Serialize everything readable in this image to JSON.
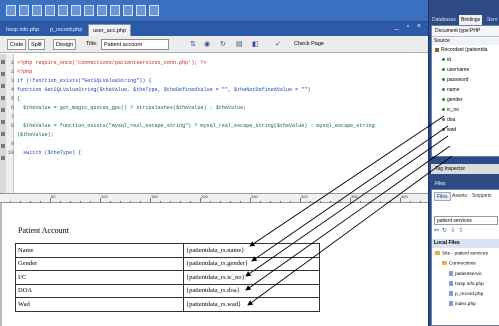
{
  "toolbar": {
    "icons": [
      "new-icon",
      "open-icon",
      "save-icon",
      "cut-icon",
      "copy-icon",
      "paste-icon",
      "undo-icon",
      "redo-icon",
      "insert-icon",
      "table-icon",
      "image-icon",
      "link-icon"
    ]
  },
  "tabs": [
    {
      "label": "hosp info.php"
    },
    {
      "label": "p_record.php"
    },
    {
      "label": "user_acc.php"
    }
  ],
  "window_controls": "_ ▫ ×",
  "view_bar": {
    "code": "Code",
    "split": "Split",
    "design": "Design",
    "title_label": "Title:",
    "title_value": "Patient account",
    "check_page": "Check Page"
  },
  "code_lines": [
    {
      "n": "1",
      "text": "<?php require_once('Connections/patientservices_conn.php'); ?>"
    },
    {
      "n": "2",
      "text": "<?php"
    },
    {
      "n": "3",
      "text": "if (!function_exists(\"GetSQLValueString\")) {"
    },
    {
      "n": "4",
      "text": "function GetSQLValueString($theValue, $theType, $theDefinedValue = \"\", $theNotDefinedValue = \"\")"
    },
    {
      "n": "5",
      "text": "{"
    },
    {
      "n": "6",
      "text": "  $theValue = get_magic_quotes_gpc() ? stripslashes($theValue) : $theValue;"
    },
    {
      "n": "7",
      "text": ""
    },
    {
      "n": "8",
      "text": "  $theValue = function_exists(\"mysql_real_escape_string\") ? mysql_real_escape_string($theValue) : mysql_escape_string"
    },
    {
      "n": "",
      "text": "($theValue);"
    },
    {
      "n": "9",
      "text": ""
    },
    {
      "n": "10",
      "text": "  switch ($theType) {"
    }
  ],
  "ruler_labels": [
    "50",
    "100",
    "150",
    "200",
    "250",
    "300",
    "350",
    "400"
  ],
  "design": {
    "title": "Patient Account",
    "rows": [
      {
        "label": "Name",
        "value": "{patientdata_rs.name}"
      },
      {
        "label": "Gender",
        "value": "{patientdata_rs.gender}"
      },
      {
        "label": "I/C",
        "value": "{patientdata_rs.ic_no}"
      },
      {
        "label": "DOA",
        "value": "{patientdata_rs.doa}"
      },
      {
        "label": "Wad",
        "value": "{patientdata_rs.wad}"
      }
    ]
  },
  "right_panel": {
    "tabs": [
      "Databases",
      "Bindings",
      "Serv"
    ],
    "doc_type": "Document type:PHP",
    "source_label": "Source",
    "recordset": "Recordset (patientda",
    "fields": [
      "id",
      "username",
      "password",
      "name",
      "gender",
      "ic_no",
      "doa",
      "wad"
    ],
    "tag_inspector": "Tag Inspector",
    "files_header": "Files",
    "files_tabs": [
      "Files",
      "Assets",
      "Snippets"
    ],
    "site_select": "patient services",
    "local_files_label": "Local Files",
    "site_root": "Site - patient services",
    "connections": "Connections",
    "connection_file": "patientservic",
    "files": [
      "hosp info.php",
      "p_record.php",
      "index.php"
    ]
  }
}
